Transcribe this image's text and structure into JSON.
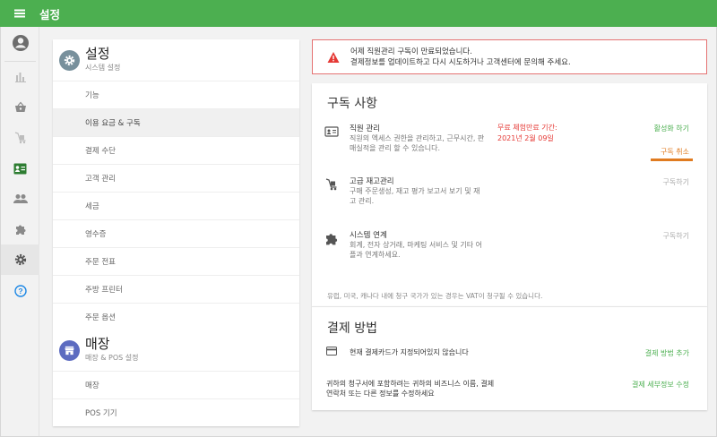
{
  "topbar": {
    "title": "설정"
  },
  "rail": {
    "items": [
      {
        "icon": "account-circle-icon"
      },
      {
        "icon": "bar-chart-icon"
      },
      {
        "icon": "basket-icon"
      },
      {
        "icon": "cart-dolly-icon"
      },
      {
        "icon": "id-card-icon"
      },
      {
        "icon": "people-icon"
      },
      {
        "icon": "puzzle-icon"
      },
      {
        "icon": "gear-icon"
      },
      {
        "icon": "help-icon"
      }
    ]
  },
  "settings_panel": {
    "section1": {
      "title": "설정",
      "subtitle": "시스템 설정"
    },
    "items": [
      "기능",
      "이용 요금 & 구독",
      "결제 수단",
      "고객 관리",
      "세금",
      "영수증",
      "주문 전표",
      "주방 프린터",
      "주문 옵션"
    ],
    "active_index": 1,
    "section2": {
      "title": "매장",
      "subtitle": "매장 & POS 설정"
    },
    "items2": [
      "매장",
      "POS 기기"
    ]
  },
  "alert": {
    "line1": "어제 직원관리 구독이 만료되었습니다.",
    "line2": "결제정보를 업데이트하고 다시 시도하거나 고객센터에 문의해 주세요."
  },
  "subscriptions": {
    "title": "구독 사항",
    "rows": [
      {
        "name": "직원 관리",
        "desc": "직원의 엑세스 권한을 관리하고, 근무시간, 판매실적을 관리 할 수 있습니다.",
        "trial_label": "무료 체험만료 기간:",
        "trial_date": "2021년 2월 09일",
        "action1": "활성화 하기",
        "action2": "구독 취소"
      },
      {
        "name": "고급 재고관리",
        "desc": "구매 주문생성, 재고 평가 보고서 보기 및 재고 관리.",
        "action1": "구독하기"
      },
      {
        "name": "시스템 연계",
        "desc": "회계, 전자 상거래, 마케팅 서비스 및 기타 어플과 연계하세요.",
        "action1": "구독하기"
      }
    ],
    "vat_note": "유럽, 미국, 캐나다 내에 청구 국가가 있는 경우는 VAT이 청구될 수 있습니다."
  },
  "payment": {
    "title": "결제 방법",
    "card_text": "현재 결제카드가 지정되어있지 않습니다",
    "card_action": "결제 방법 추가",
    "info_text": "귀하의 청구서에 포함하려는 귀하의 비즈니스 이름, 결제 연락처 또는 다른 정보를 수정하세요",
    "info_action": "결제 세부정보 수정"
  },
  "colors": {
    "brand_green": "#4caf50",
    "alert_red": "#e53935",
    "cancel_orange": "#e07b20"
  }
}
